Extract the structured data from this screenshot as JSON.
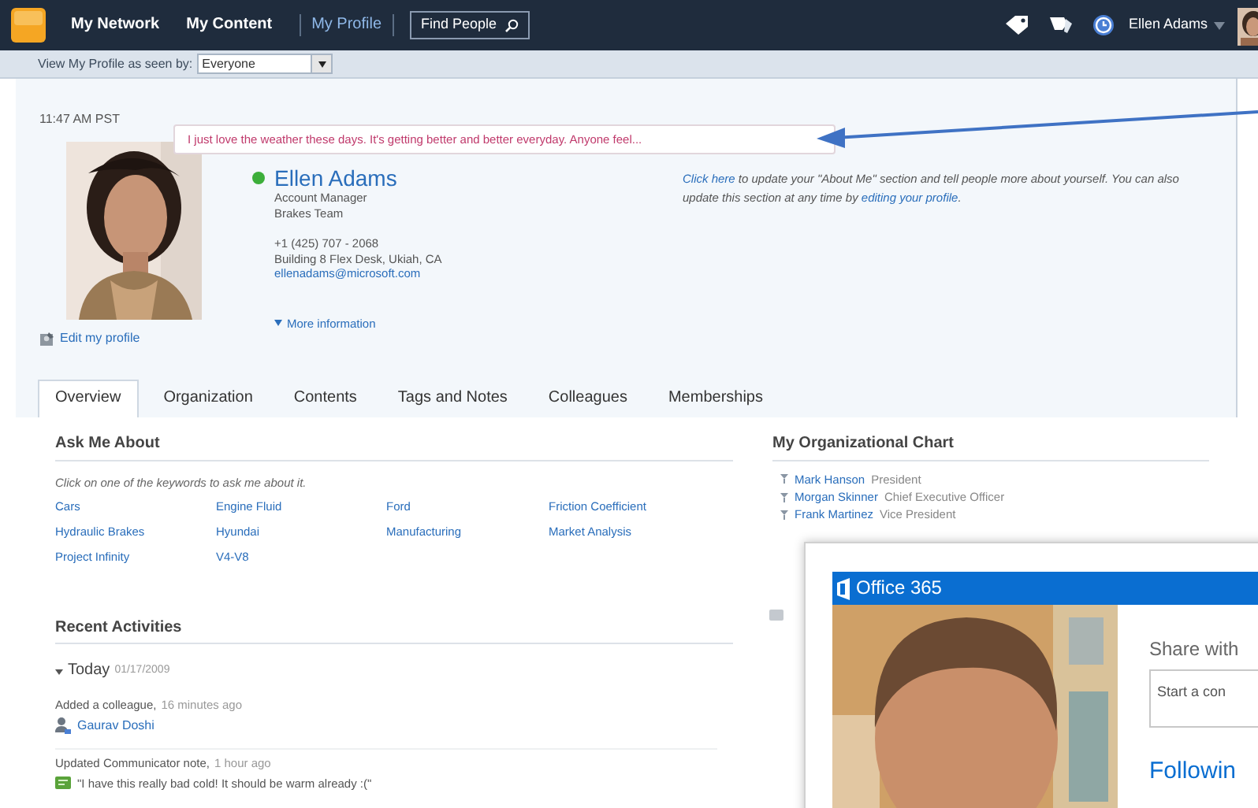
{
  "top_nav": {
    "items": [
      {
        "label": "My Network",
        "selected": false
      },
      {
        "label": "My Content",
        "selected": false
      },
      {
        "label": "My Profile",
        "selected": true
      }
    ],
    "search_button": "Find People",
    "user_name": "Ellen Adams"
  },
  "view_bar": {
    "label": "View My Profile as seen by:",
    "value": "Everyone"
  },
  "profile": {
    "time": "11:47 AM PST",
    "status_note": "I just love the weather these days. It's getting better and better everyday. Anyone feel...",
    "name": "Ellen Adams",
    "details": [
      "Account Manager",
      "Brakes Team"
    ],
    "contact": [
      "+1 (425) 707 - 2068",
      "Building 8 Flex Desk, Ukiah, CA"
    ],
    "email": "ellenadams@microsoft.com",
    "edit_link": "Edit my profile",
    "more_link": "More information",
    "about_prompt": [
      {
        "text": "Click here",
        "link": true
      },
      {
        "text": " to update your \"About Me\" section and tell people more about yourself. You can also update this section at any time by ",
        "link": false
      },
      {
        "text": "editing your profile",
        "link": true
      },
      {
        "text": ".",
        "link": false
      }
    ]
  },
  "tabs": [
    {
      "label": "Overview",
      "selected": true
    },
    {
      "label": "Organization",
      "selected": false
    },
    {
      "label": "Contents",
      "selected": false
    },
    {
      "label": "Tags and Notes",
      "selected": false
    },
    {
      "label": "Colleagues",
      "selected": false
    },
    {
      "label": "Memberships",
      "selected": false
    }
  ],
  "ask_me_about": {
    "title": "Ask Me About",
    "hint": "Click on one of the keywords to ask me about it.",
    "keywords": [
      "Cars",
      "Engine Fluid",
      "Ford",
      "Friction Coefficient",
      "Hydraulic Brakes",
      "Hyundai",
      "Manufacturing",
      "Market Analysis",
      "Project Infinity",
      "V4-V8"
    ]
  },
  "recent_activities": {
    "title": "Recent Activities",
    "group": {
      "label": "Today",
      "date": "01/17/2009",
      "expanded": true
    },
    "items": [
      {
        "kind": "colleague",
        "text": "Added a colleague,",
        "time": "16 minutes ago",
        "detail": "Gaurav Doshi"
      },
      {
        "kind": "note",
        "text": "Updated Communicator note,",
        "time": "1 hour ago",
        "detail": "\"I have this really bad cold! It should be warm already :(\""
      }
    ]
  },
  "org_chart": {
    "title": "My Organizational Chart",
    "people": [
      {
        "name": "Mark Hanson",
        "role": "President"
      },
      {
        "name": "Morgan Skinner",
        "role": "Chief Executive Officer"
      },
      {
        "name": "Frank Martinez",
        "role": "Vice President"
      }
    ]
  },
  "overlay": {
    "brand": "Office 365",
    "share_label": "Share with",
    "input_placeholder": "Start a con",
    "following": "Followin"
  }
}
